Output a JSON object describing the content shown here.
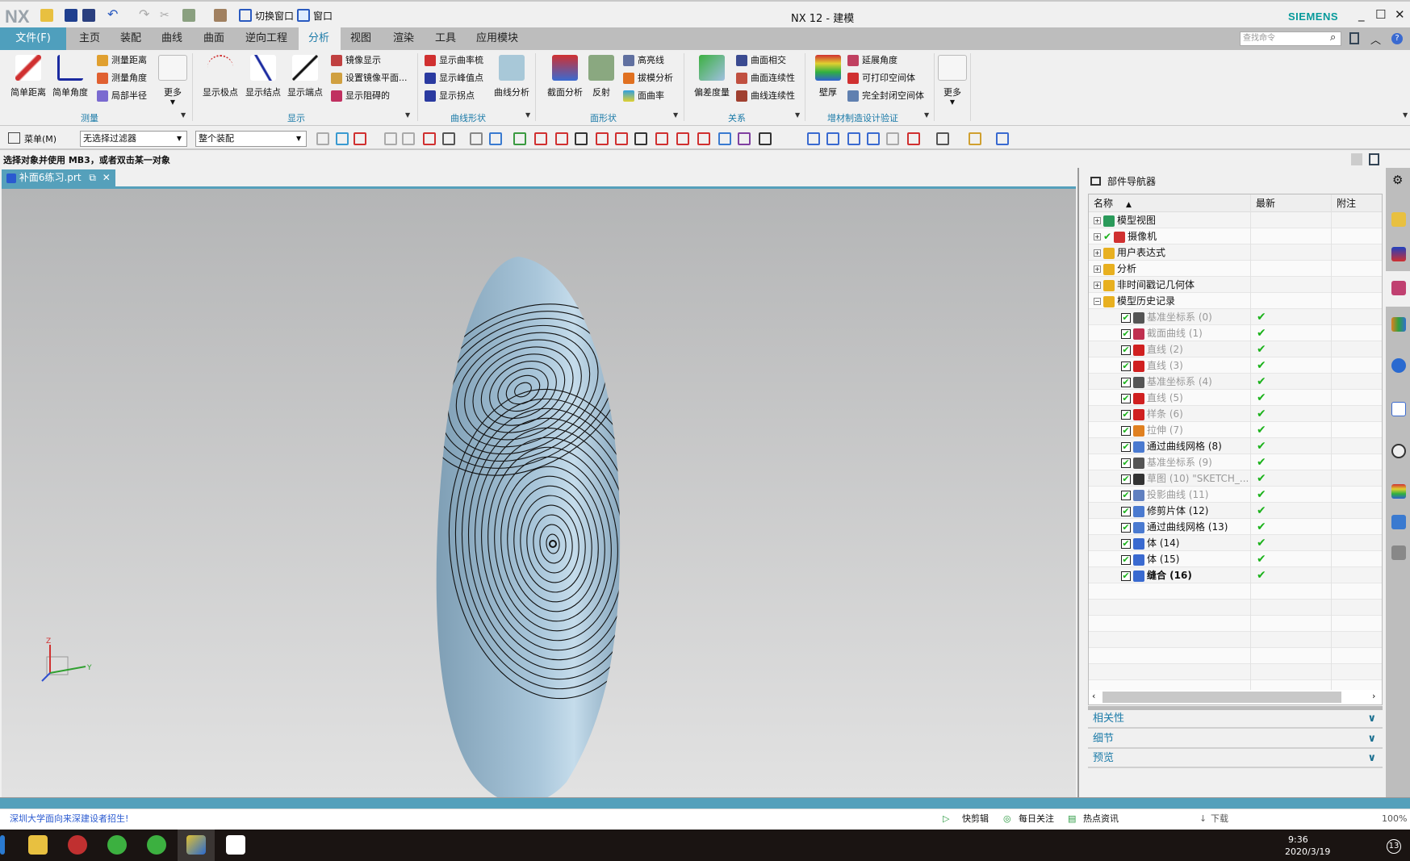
{
  "app": {
    "logo": "NX",
    "title": "NX 12 - 建模",
    "brand": "SIEMENS",
    "switch_window": "切换窗口",
    "window_menu": "窗口"
  },
  "tabs": [
    "文件(F)",
    "主页",
    "装配",
    "曲线",
    "曲面",
    "逆向工程",
    "分析",
    "视图",
    "渲染",
    "工具",
    "应用模块"
  ],
  "active_tab": "分析",
  "search": {
    "placeholder": "查找命令"
  },
  "ribbon": {
    "groups": [
      "测量",
      "显示",
      "曲线形状",
      "面形状",
      "关系",
      "增材制造设计验证"
    ],
    "measure": {
      "simple_distance": "简单距离",
      "simple_angle": "简单角度",
      "measure_distance": "测量距离",
      "measure_angle": "测量角度",
      "local_radius": "局部半径",
      "more": "更多"
    },
    "display": {
      "show_poles": "显示极点",
      "show_knots": "显示结点",
      "show_endpoints": "显示端点",
      "mirror_display": "镜像显示",
      "set_mirror_plane": "设置镜像平面...",
      "show_obstructing": "显示阻碍的"
    },
    "curve_shape": {
      "curvature_comb": "显示曲率梳",
      "peak_points": "显示峰值点",
      "inflection": "显示拐点",
      "curve_analysis": "曲线分析"
    },
    "face_shape": {
      "section_analysis": "截面分析",
      "reflection": "反射",
      "highlight_lines": "高亮线",
      "draft_analysis": "拔模分析",
      "face_curvature": "面曲率"
    },
    "relation": {
      "deviation_gauge": "偏差度量",
      "surface_intersection": "曲面相交",
      "surface_continuity": "曲面连续性",
      "curve_continuity": "曲线连续性"
    },
    "additive": {
      "wall_thickness": "壁厚",
      "overhang_angle": "延展角度",
      "printable_volume": "可打印空间体",
      "enclosed_volume": "完全封闭空间体"
    },
    "more": "更多"
  },
  "toolbar": {
    "menu": "菜单(M)",
    "filter": "无选择过滤器",
    "scope": "整个装配"
  },
  "status": "选择对象并使用 MB3，或者双击某一对象",
  "document_tab": "补面6练习.prt",
  "navigator": {
    "title": "部件导航器",
    "columns": [
      "名称",
      "最新",
      "附注"
    ],
    "top_nodes": [
      {
        "label": "模型视图",
        "color": "#2a9a5a"
      },
      {
        "label": "摄像机",
        "color": "#d03030"
      },
      {
        "label": "用户表达式",
        "color": "#e8b020"
      },
      {
        "label": "分析",
        "color": "#e8b020"
      },
      {
        "label": "非时间戳记几何体",
        "color": "#e8b020"
      },
      {
        "label": "模型历史记录",
        "color": "#e8b020"
      }
    ],
    "features": [
      {
        "label": "基准坐标系 (0)",
        "dim": true,
        "color": "#555"
      },
      {
        "label": "截面曲线 (1)",
        "dim": true,
        "color": "#c03050"
      },
      {
        "label": "直线 (2)",
        "dim": true,
        "color": "#d02020"
      },
      {
        "label": "直线 (3)",
        "dim": true,
        "color": "#d02020"
      },
      {
        "label": "基准坐标系 (4)",
        "dim": true,
        "color": "#555"
      },
      {
        "label": "直线 (5)",
        "dim": true,
        "color": "#d02020"
      },
      {
        "label": "样条 (6)",
        "dim": true,
        "color": "#d02020"
      },
      {
        "label": "拉伸 (7)",
        "dim": true,
        "color": "#e08020"
      },
      {
        "label": "通过曲线网格 (8)",
        "dim": false,
        "color": "#4a7ad0"
      },
      {
        "label": "基准坐标系 (9)",
        "dim": true,
        "color": "#555"
      },
      {
        "label": "草图 (10) \"SKETCH_...",
        "dim": true,
        "color": "#333"
      },
      {
        "label": "投影曲线 (11)",
        "dim": true,
        "color": "#6080c0"
      },
      {
        "label": "修剪片体 (12)",
        "dim": false,
        "color": "#4a7ad0"
      },
      {
        "label": "通过曲线网格 (13)",
        "dim": false,
        "color": "#4a7ad0"
      },
      {
        "label": "体 (14)",
        "dim": false,
        "color": "#3a6ad0"
      },
      {
        "label": "体 (15)",
        "dim": false,
        "color": "#3a6ad0"
      },
      {
        "label": "缝合 (16)",
        "dim": false,
        "bold": true,
        "color": "#3a6ad0"
      }
    ],
    "latest_mark": "✔",
    "sections": [
      "相关性",
      "细节",
      "预览"
    ]
  },
  "browser_status": {
    "news": "深圳大学面向来深建设者招生!",
    "items": [
      "快剪辑",
      "每日关注",
      "热点资讯",
      "下载"
    ],
    "zoom": "100%"
  },
  "taskbar": {
    "time": "9:36",
    "date": "2020/3/19",
    "notifications": "13"
  },
  "colors": {
    "accent": "#55a0bb",
    "file_tab": "#4f9fbd",
    "group_label": "#1a7aa8",
    "surface": "#9dbfd6",
    "check": "#1bb21b"
  }
}
